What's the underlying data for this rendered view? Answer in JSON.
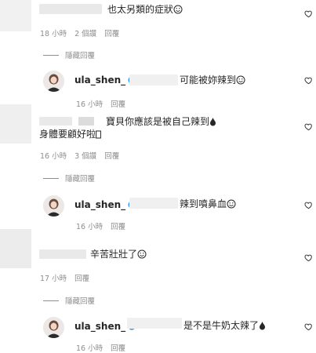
{
  "comments": [
    {
      "text": "也太另類的症狀",
      "time": "18 小時",
      "likes": "2 個讚",
      "reply": "回覆",
      "hidden_replies": "隱藏回覆",
      "reply_item": {
        "handle": "ula_shen_",
        "text": "可能被妳辣到",
        "time": "16 小時",
        "reply": "回覆"
      }
    },
    {
      "text_line1": "寶貝你應該是被自己辣到",
      "text_line2": "身體要顧好啦",
      "time": "16 小時",
      "likes": "3 個讚",
      "reply": "回覆",
      "hidden_replies": "隱藏回覆",
      "reply_item": {
        "handle": "ula_shen_",
        "text": "辣到噴鼻血",
        "time": "16 小時",
        "reply": "回覆"
      }
    },
    {
      "text": "辛苦壯壯了",
      "time": "17 小時",
      "reply": "回覆",
      "hidden_replies": "隱藏回覆",
      "reply_item": {
        "handle": "ula_shen_",
        "text": "是不是牛奶太辣了",
        "time": "16 小時",
        "reply": "回覆"
      }
    }
  ],
  "icons": {
    "like": "heart-outline-icon",
    "verified": "verified-badge-icon",
    "smile": "smiling-face-emoji",
    "fire": "drop-emoji"
  },
  "colors": {
    "text": "#262626",
    "meta": "#8e8e8e",
    "verified": "#3897f0"
  }
}
